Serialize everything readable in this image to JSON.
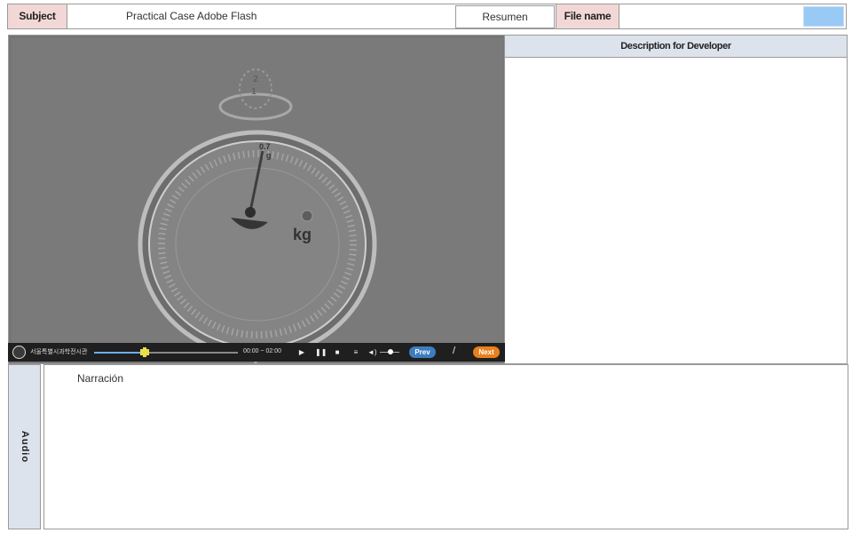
{
  "header": {
    "subject_label": "Subject",
    "subject_value": "Practical Case Adobe Flash",
    "resumen_label": "Resumen",
    "file_name_label": "File name",
    "file_name_value": "",
    "accent_color": "#99c9f5"
  },
  "media": {
    "dial_value_top": "0.7",
    "dial_unit_small": "g",
    "dial_unit": "kg",
    "top_digit_1": "2",
    "top_digit_2": "1"
  },
  "player": {
    "logo_text": "서울특별시과학전시관",
    "progress": 0.35,
    "time_text": "00:00 ~ 02:00",
    "play_icon": "play-icon",
    "pause_icon": "pause-icon",
    "stop_icon": "stop-icon",
    "menu_icon": "menu-icon",
    "volume_icon": "volume-icon",
    "prev_label": "Prev",
    "separator": "/",
    "next_label": "Next",
    "prev_color": "#3e7cc0",
    "next_color": "#e8801c"
  },
  "description": {
    "title": "Description for Developer",
    "body": ""
  },
  "audio": {
    "label": "Audio",
    "narration": "Narración"
  }
}
